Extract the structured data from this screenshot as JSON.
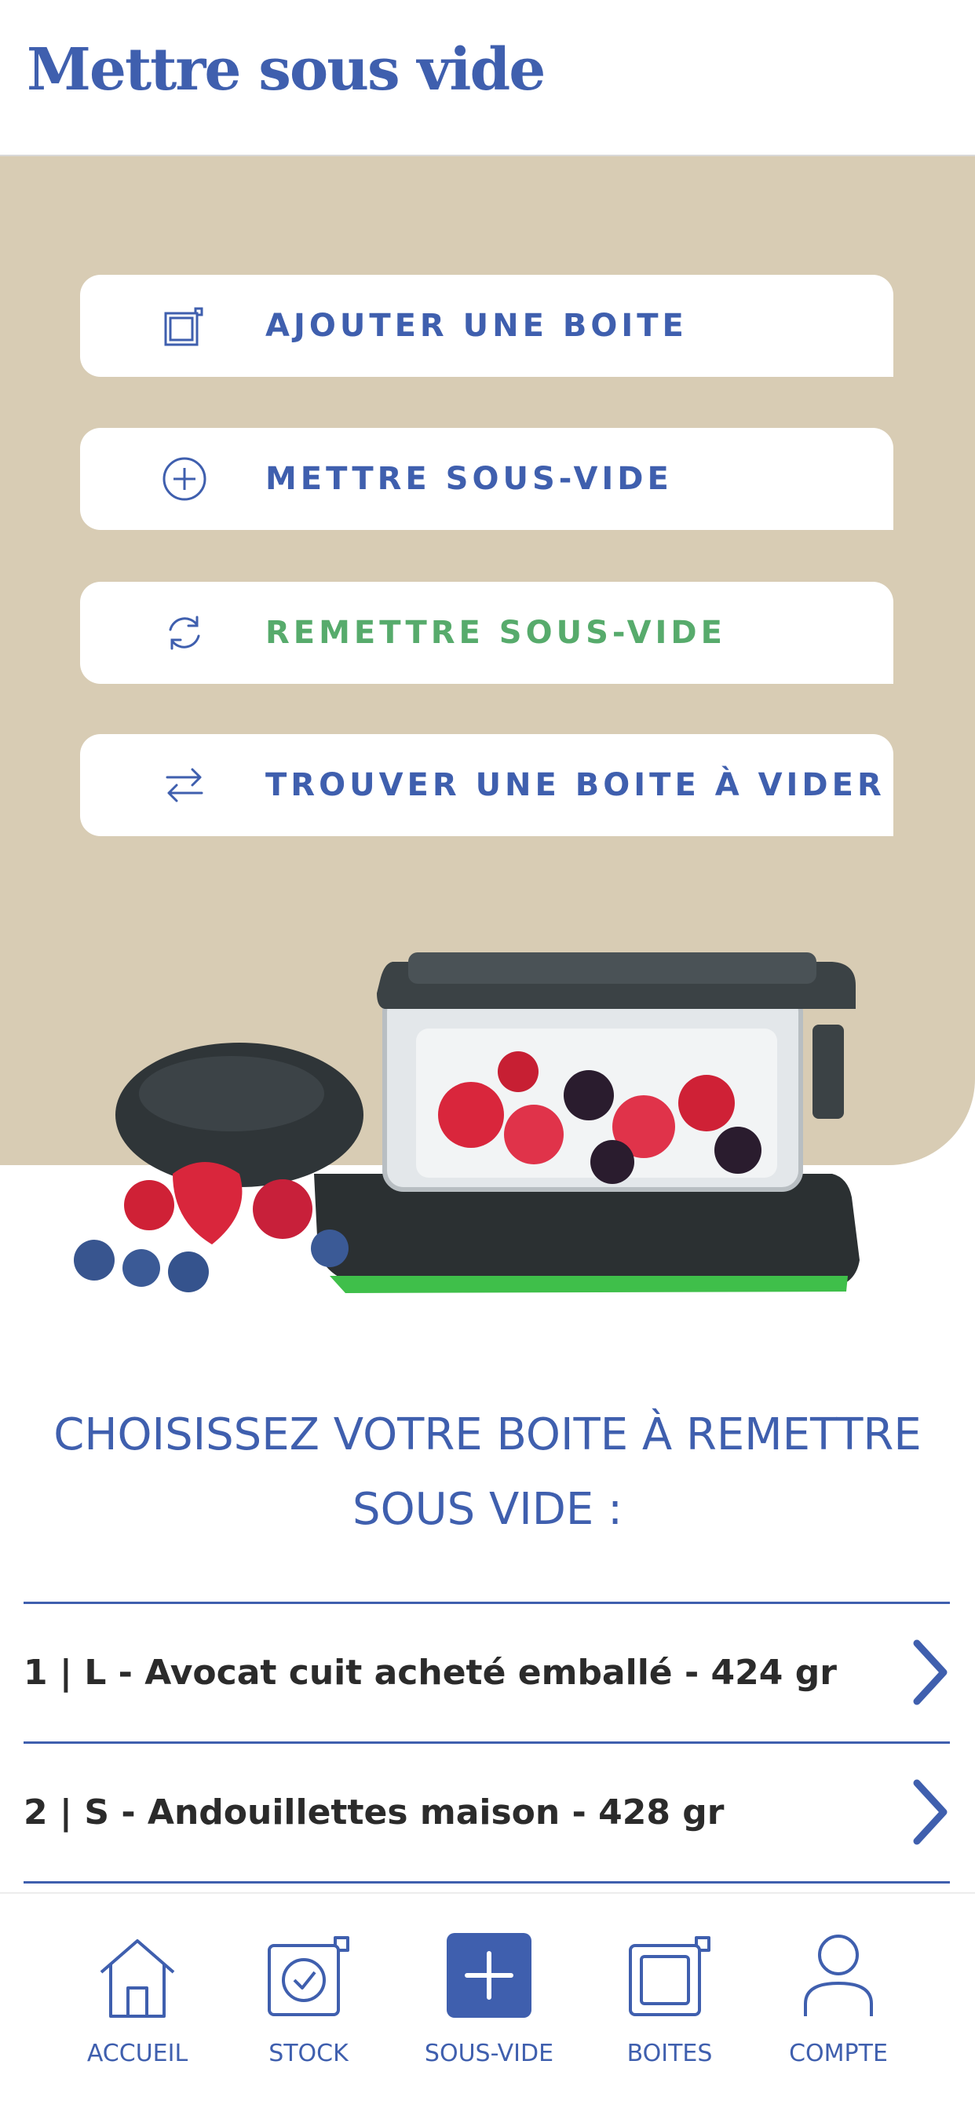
{
  "header": {
    "title": "Mettre sous vide"
  },
  "actions": [
    {
      "label": "AJOUTER UNE BOITE",
      "icon": "box-add-icon"
    },
    {
      "label": "METTRE SOUS-VIDE",
      "icon": "plus-circle-icon"
    },
    {
      "label": "REMETTRE SOUS-VIDE",
      "icon": "refresh-icon",
      "active": true
    },
    {
      "label": "TROUVER UNE BOITE À VIDER",
      "icon": "swap-arrows-icon"
    }
  ],
  "hero": {
    "image": "vacuum-box-with-berries"
  },
  "prompt": {
    "line1": "CHOISISSEZ VOTRE BOITE À REMETTRE",
    "line2": "SOUS VIDE :"
  },
  "boxes": [
    {
      "label": "1 | L - Avocat cuit acheté emballé - 424 gr"
    },
    {
      "label": "2 | S - Andouillettes maison - 428 gr"
    }
  ],
  "nav": [
    {
      "label": "ACCUEIL",
      "icon": "home-icon"
    },
    {
      "label": "STOCK",
      "icon": "stock-check-icon"
    },
    {
      "label": "SOUS-VIDE",
      "icon": "plus-square-icon",
      "active": true
    },
    {
      "label": "BOITES",
      "icon": "box-icon"
    },
    {
      "label": "COMPTE",
      "icon": "user-icon"
    }
  ],
  "colors": {
    "primary": "#3f5fae",
    "accent_green": "#57ab6c",
    "beige": "#d8ccb4",
    "text_dark": "#2b2b2b"
  }
}
